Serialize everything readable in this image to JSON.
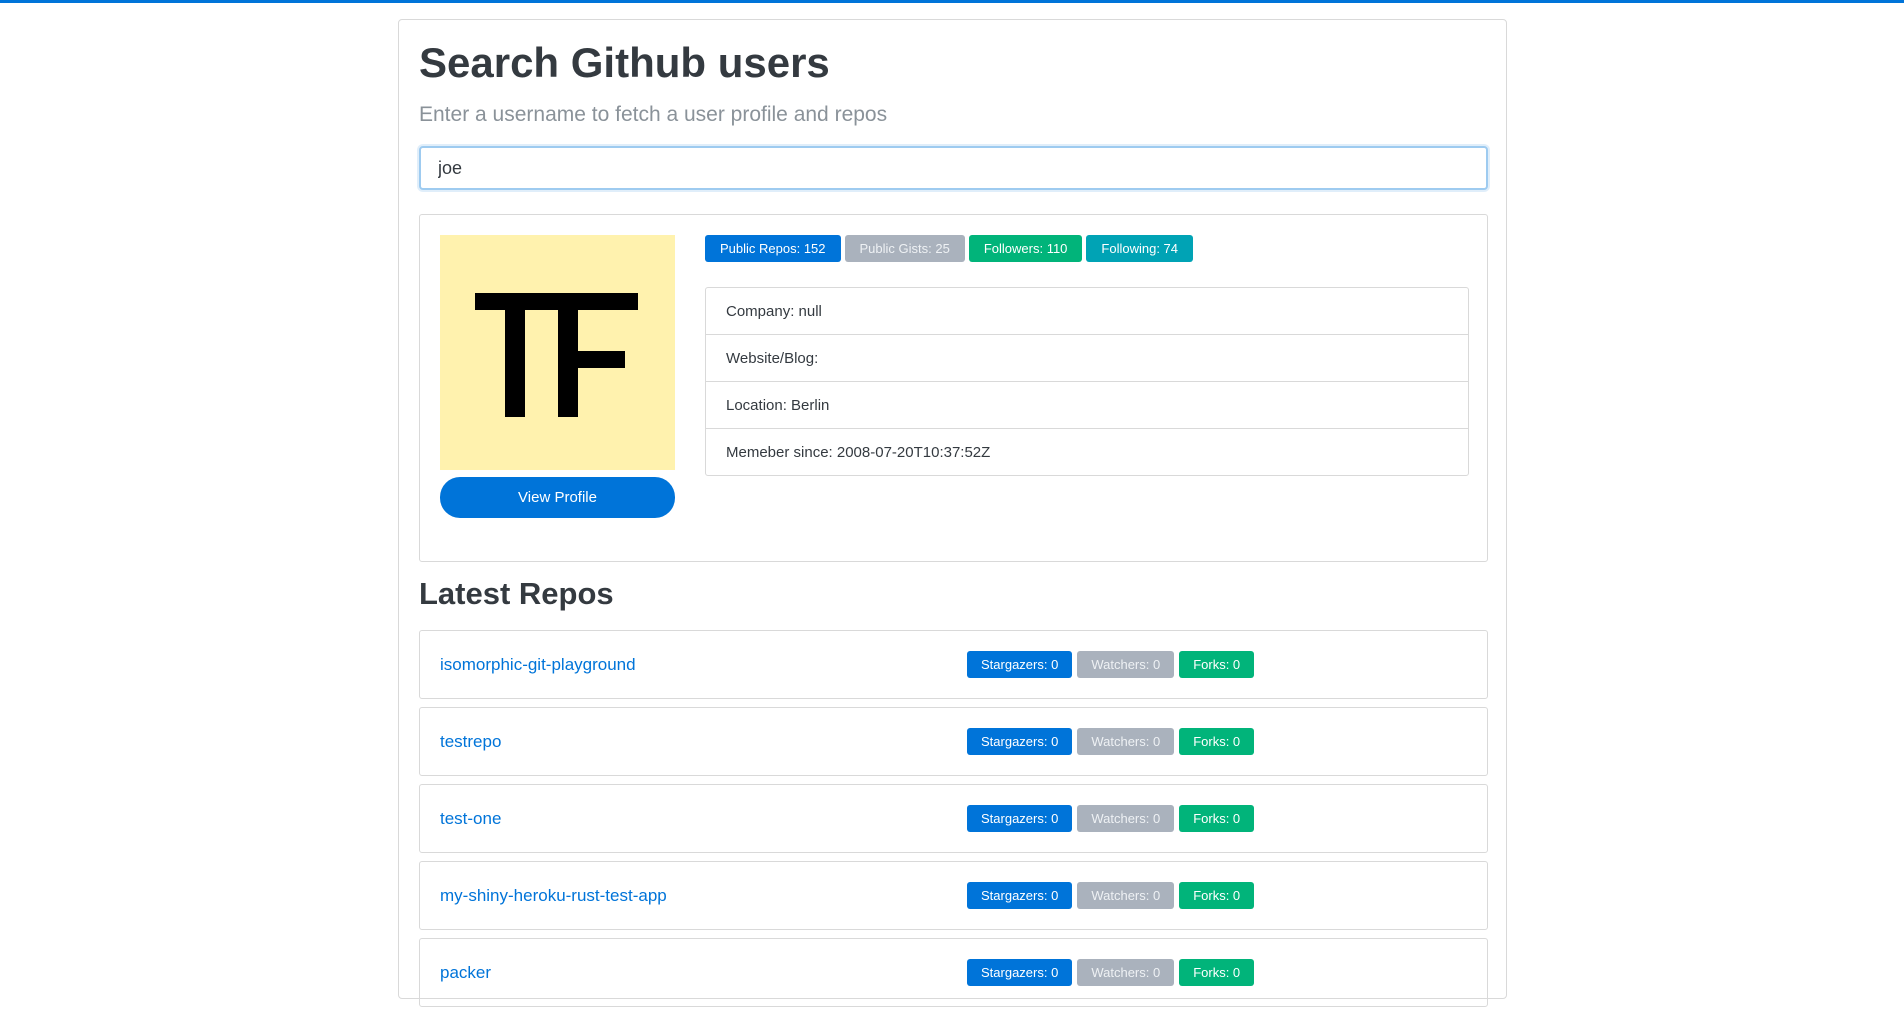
{
  "header": {
    "title": "Search Github users",
    "subtitle": "Enter a username to fetch a user profile and repos"
  },
  "search": {
    "value": "joe"
  },
  "profile": {
    "avatar_text": "TF",
    "view_profile_label": "View Profile",
    "badges": {
      "public_repos": "Public Repos: 152",
      "public_gists": "Public Gists: 25",
      "followers": "Followers: 110",
      "following": "Following: 74"
    },
    "details": {
      "company": "Company: null",
      "website": "Website/Blog:",
      "location": "Location: Berlin",
      "member_since": "Memeber since: 2008-07-20T10:37:52Z"
    }
  },
  "repos": {
    "title": "Latest Repos",
    "items": [
      {
        "name": "isomorphic-git-playground",
        "stargazers": "Stargazers: 0",
        "watchers": "Watchers: 0",
        "forks": "Forks: 0"
      },
      {
        "name": "testrepo",
        "stargazers": "Stargazers: 0",
        "watchers": "Watchers: 0",
        "forks": "Forks: 0"
      },
      {
        "name": "test-one",
        "stargazers": "Stargazers: 0",
        "watchers": "Watchers: 0",
        "forks": "Forks: 0"
      },
      {
        "name": "my-shiny-heroku-rust-test-app",
        "stargazers": "Stargazers: 0",
        "watchers": "Watchers: 0",
        "forks": "Forks: 0"
      },
      {
        "name": "packer",
        "stargazers": "Stargazers: 0",
        "watchers": "Watchers: 0",
        "forks": "Forks: 0"
      }
    ]
  },
  "colors": {
    "primary": "#0074d9",
    "secondary": "#aab2bd",
    "success": "#01b47a",
    "info": "#00a3b5",
    "avatar_bg": "#fff2ae"
  }
}
